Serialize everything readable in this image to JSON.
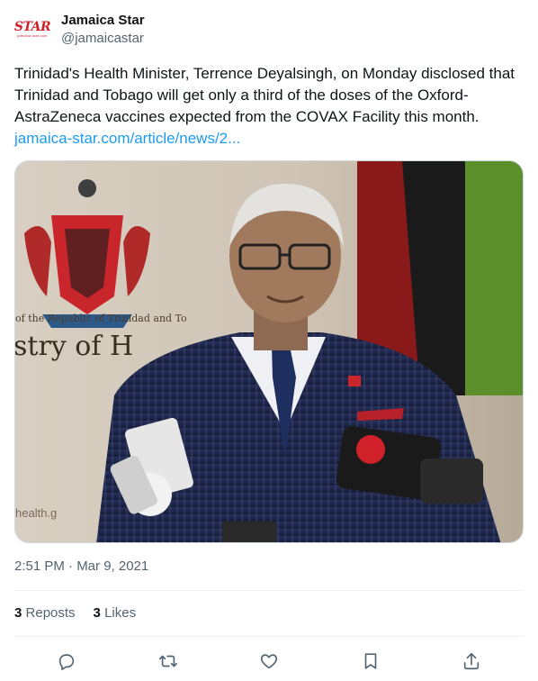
{
  "account": {
    "logo_text": "STAR",
    "logo_subtext": "jamaica-star.com",
    "display_name": "Jamaica Star",
    "handle": "@jamaicastar"
  },
  "tweet": {
    "text": "Trinidad's Health Minister, Terrence Deyalsingh, on Monday disclosed that Trinidad and Tobago will get only a third of the doses of the Oxford-AstraZeneca vaccines expected from the COVAX Facility this month.",
    "link_text": "jamaica-star.com/article/news/2..."
  },
  "media": {
    "backdrop_text_1": "of the Republic of Trinidad and To",
    "backdrop_text_2": "stry of H",
    "backdrop_text_3": "health.g"
  },
  "timestamp": "2:51 PM · Mar 9, 2021",
  "stats": {
    "reposts_count": "3",
    "reposts_label": "Reposts",
    "likes_count": "3",
    "likes_label": "Likes"
  },
  "actions": [
    "reply-icon",
    "repost-icon",
    "like-icon",
    "bookmark-icon",
    "share-icon"
  ],
  "colors": {
    "link": "#1d9bf0",
    "secondary_text": "#536471",
    "logo_red": "#d0202a"
  }
}
